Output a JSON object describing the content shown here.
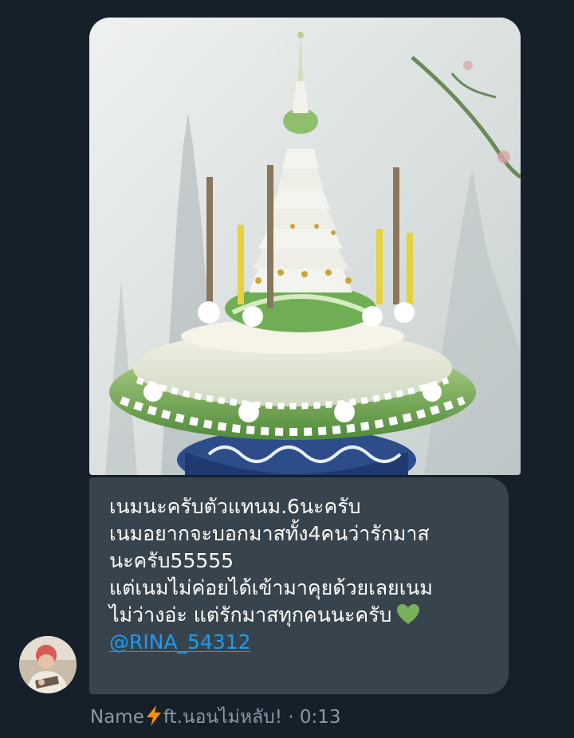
{
  "conversation": {
    "message": {
      "image": {
        "alt_icon": "photo-icon"
      },
      "text_lines": [
        "เนมนะครับตัวแทนม.6นะครับ",
        "เนมอยากจะบอกมาสทั้ง4คนว่ารักมาส",
        "นะครับ55555",
        "แต่เนมไม่ค่อยได้เข้ามาคุยด้วยเลยเนม",
        "ไม่ว่างอ่ะ แต่รักมาสทุกคนนะครับ"
      ],
      "emoji": "green-heart-icon",
      "mention": "@RINA_54312",
      "sender": {
        "name_prefix": "Name",
        "name_emoji": "lightning-icon",
        "name_suffix": "ft.นอนไม่หลับ!",
        "separator": "·",
        "time": "0:13"
      }
    }
  },
  "colors": {
    "background": "#15202b",
    "bubble": "#38444d",
    "text": "#ffffff",
    "link": "#1d9bf0",
    "meta": "#8b98a5",
    "heart": "#78b159",
    "bolt": "#f4900c"
  }
}
